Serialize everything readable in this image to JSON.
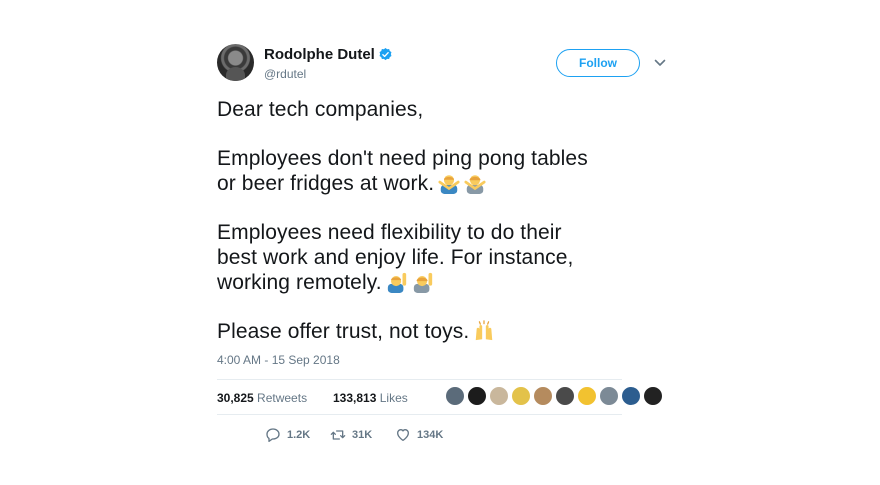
{
  "author": {
    "display_name": "Rodolphe Dutel",
    "handle": "@rdutel",
    "verified": true
  },
  "follow_label": "Follow",
  "tweet": {
    "lines": [
      "Dear tech companies,",
      "Employees don't need ping pong tables",
      "or beer fridges at work.",
      "Employees need flexibility to do their",
      "best work and enjoy life. For instance,",
      "working remotely.",
      "Please offer trust, not toys."
    ],
    "emojis": {
      "no_gesture": [
        "person-gesturing-no-man-emoji",
        "person-gesturing-no-woman-emoji"
      ],
      "raising_hand": [
        "man-raising-hand-emoji",
        "woman-raising-hand-emoji"
      ],
      "celebrate": "raising-hands-emoji"
    }
  },
  "timestamp": "4:00 AM - 15 Sep 2018",
  "stats": {
    "retweets_count": "30,825",
    "retweets_label": "Retweets",
    "likes_count": "133,813",
    "likes_label": "Likes"
  },
  "actions": {
    "reply_count": "1.2K",
    "retweet_count": "31K",
    "like_count": "134K"
  },
  "colors": {
    "accent": "#1da1f2",
    "secondary_text": "#657786",
    "divider": "#e6ecf0"
  }
}
